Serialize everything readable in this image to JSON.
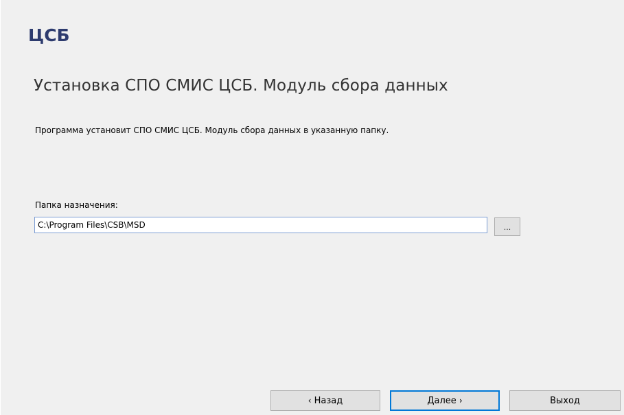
{
  "logo": {
    "text": "ЦСБ"
  },
  "title": "Установка СПО СМИС ЦСБ. Модуль сбора данных",
  "description": "Программа установит СПО СМИС ЦСБ. Модуль сбора данных в указанную папку.",
  "folder": {
    "label": "Папка назначения:",
    "value": "C:\\Program Files\\CSB\\MSD",
    "browse_label": "..."
  },
  "buttons": {
    "back_label": "Назад",
    "back_icon": "‹",
    "next_label": "Далее",
    "next_icon": "›",
    "exit_label": "Выход"
  },
  "colors": {
    "logo": "#2d3b6e",
    "accent": "#0078d7"
  }
}
